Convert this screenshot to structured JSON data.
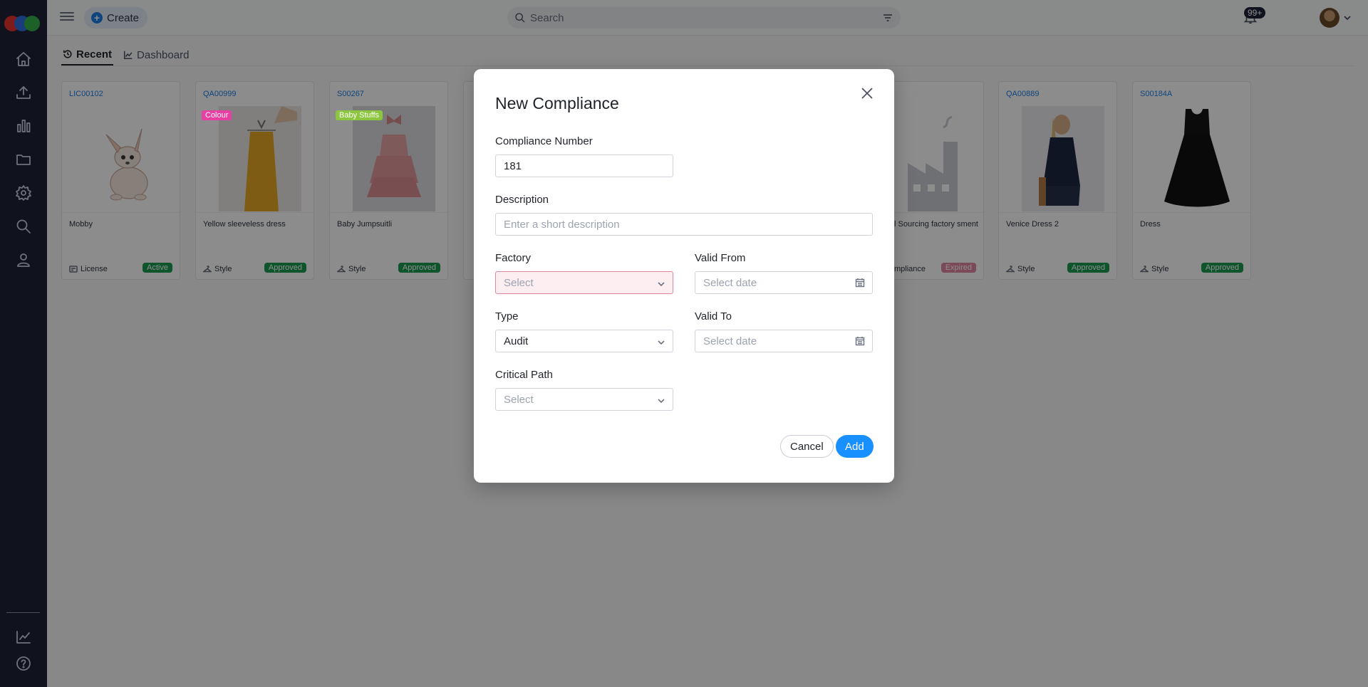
{
  "topbar": {
    "create_label": "Create",
    "search_placeholder": "Search",
    "notification_count": "99+"
  },
  "tabs": [
    {
      "label": "Recent",
      "icon": "history-icon",
      "active": true
    },
    {
      "label": "Dashboard",
      "icon": "chart-line-icon",
      "active": false
    }
  ],
  "cards": [
    {
      "code": "LIC00102",
      "title": "Mobby",
      "type": "License",
      "status": "Active",
      "status_color": "#1a9b4f",
      "tag": ""
    },
    {
      "code": "QA00999",
      "title": "Yellow sleeveless dress",
      "type": "Style",
      "status": "Approved",
      "status_color": "#1a9b4f",
      "tag": "Colour",
      "tag_color": "#e73fa2"
    },
    {
      "code": "S00267",
      "title": "Baby Jumpsuitli",
      "type": "Style",
      "status": "Approved",
      "status_color": "#1a9b4f",
      "tag": "Baby Stuffs",
      "tag_color": "#8cc63f"
    },
    {
      "code": "",
      "title": "l Sourcing factory sment",
      "type": "mpliance",
      "status": "Expired",
      "status_color": "#e0859e",
      "tag": ""
    },
    {
      "code": "QA00889",
      "title": "Venice Dress 2",
      "type": "Style",
      "status": "Approved",
      "status_color": "#1a9b4f",
      "tag": ""
    },
    {
      "code": "S00184A",
      "title": "Dress",
      "type": "Style",
      "status": "Approved",
      "status_color": "#1a9b4f",
      "tag": ""
    }
  ],
  "modal": {
    "title": "New Compliance",
    "compliance_number_label": "Compliance Number",
    "compliance_number_value": "181",
    "description_label": "Description",
    "description_placeholder": "Enter a short description",
    "factory_label": "Factory",
    "factory_placeholder": "Select",
    "valid_from_label": "Valid From",
    "valid_from_placeholder": "Select date",
    "type_label": "Type",
    "type_value": "Audit",
    "valid_to_label": "Valid To",
    "valid_to_placeholder": "Select date",
    "critical_path_label": "Critical Path",
    "critical_path_placeholder": "Select",
    "cancel_label": "Cancel",
    "add_label": "Add"
  },
  "colors": {
    "sidebar_bg": "#1e2238",
    "primary": "#1890ff",
    "error_border": "#e0859e"
  }
}
